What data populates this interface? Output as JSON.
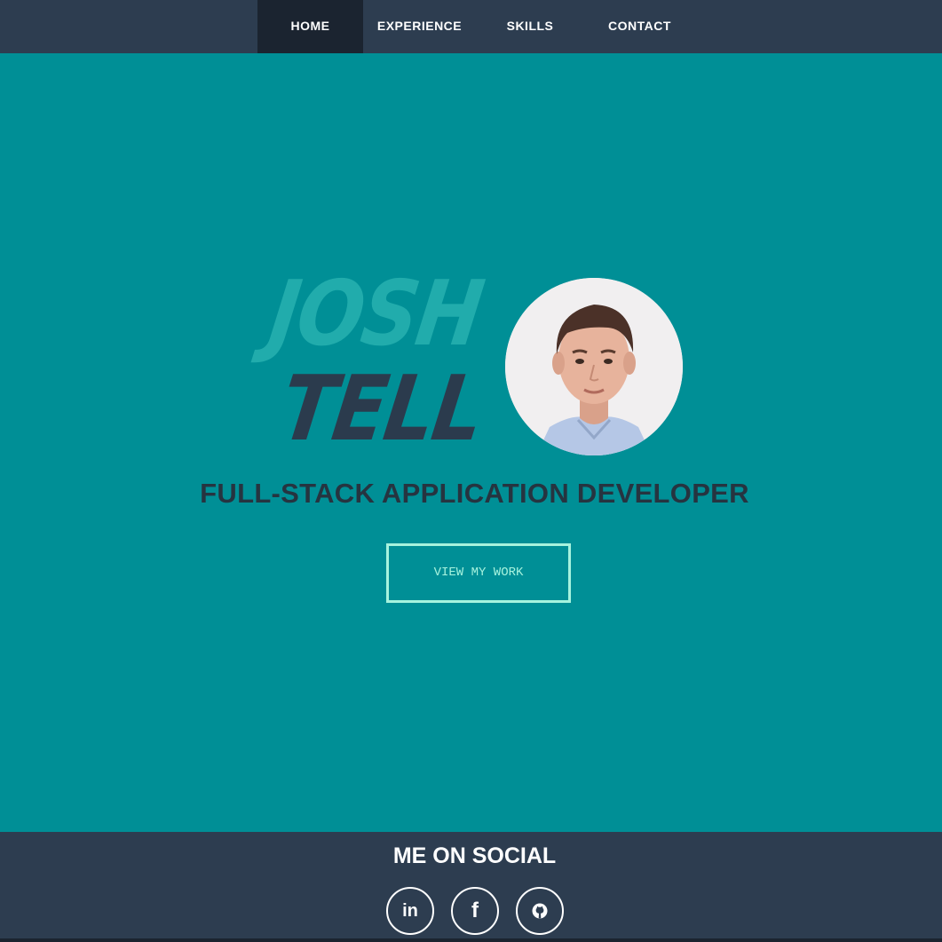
{
  "nav": {
    "items": [
      {
        "label": "HOME",
        "active": true
      },
      {
        "label": "EXPERIENCE",
        "active": false
      },
      {
        "label": "SKILLS",
        "active": false
      },
      {
        "label": "CONTACT",
        "active": false
      }
    ]
  },
  "hero": {
    "first_name": "JOSH",
    "last_name": "TELL",
    "subtitle": "FULL-STACK APPLICATION DEVELOPER",
    "cta_label": "VIEW MY WORK"
  },
  "footer": {
    "title": "ME ON SOCIAL",
    "social": [
      {
        "icon": "linkedin-icon",
        "glyph": "in"
      },
      {
        "icon": "facebook-icon",
        "glyph": "f"
      },
      {
        "icon": "github-icon",
        "glyph": ""
      }
    ]
  },
  "colors": {
    "hero_bg": "#008f96",
    "nav_bg": "#2d3d50",
    "nav_active_bg": "#1b2430",
    "first_name": "#21acac",
    "last_name": "#2b3b4d",
    "cta_accent": "#a6f3de"
  }
}
